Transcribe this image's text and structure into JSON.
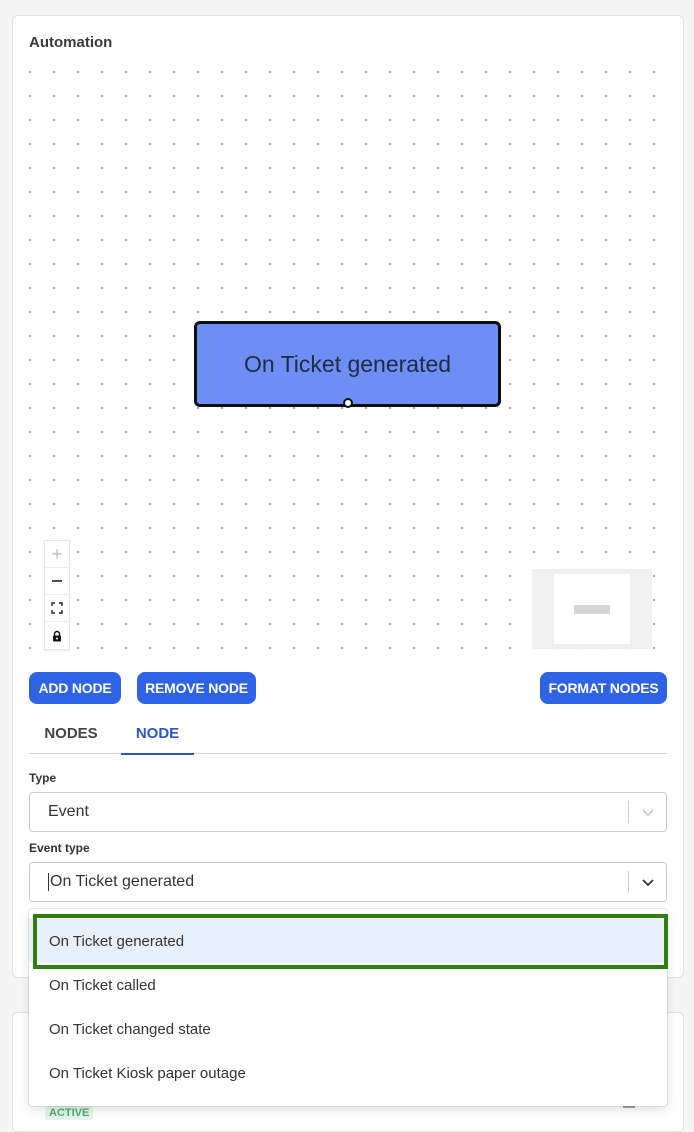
{
  "card": {
    "title": "Automation"
  },
  "flow": {
    "node_label": "On Ticket generated"
  },
  "controls": {
    "zoom_in": "+",
    "zoom_out": "—",
    "fit_view": "⛶",
    "lock": "🔒"
  },
  "actions": {
    "add_node": "ADD NODE",
    "remove_node": "REMOVE NODE",
    "format_nodes": "FORMAT NODES"
  },
  "tabs": [
    {
      "label": "NODES",
      "active": false
    },
    {
      "label": "NODE",
      "active": true
    }
  ],
  "form": {
    "type_label": "Type",
    "type_value": "Event",
    "event_type_label": "Event type",
    "event_type_value": "On Ticket generated"
  },
  "dropdown": {
    "options": [
      {
        "label": "On Ticket generated",
        "selected": true
      },
      {
        "label": "On Ticket called",
        "selected": false
      },
      {
        "label": "On Ticket changed state",
        "selected": false
      },
      {
        "label": "On Ticket Kiosk paper outage",
        "selected": false
      }
    ]
  },
  "lower_card": {
    "status_badge": "ACTIVE"
  },
  "colors": {
    "primary": "#2e63e6",
    "node_fill": "#6d8ff5",
    "tab_active": "#2a55c9",
    "highlight_border": "#2f7d13",
    "selected_option_bg": "#e8f0fb"
  }
}
